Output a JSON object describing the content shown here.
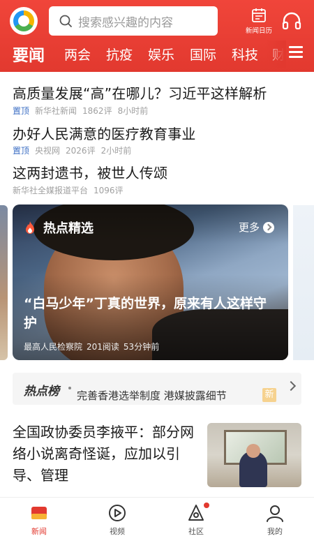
{
  "header": {
    "search_placeholder": "搜索感兴趣的内容",
    "calendar_label": "新闻日历",
    "brand_color": "#e2392f",
    "icons": [
      "app-logo-icon",
      "search-icon",
      "calendar-icon",
      "headphone-icon",
      "menu-icon"
    ]
  },
  "channels": [
    "要闻",
    "两会",
    "抗疫",
    "娱乐",
    "国际",
    "科技",
    "财"
  ],
  "feed": [
    {
      "title": "高质量发展“高”在哪儿？习近平这样解析",
      "pin": "置顶",
      "source": "新华社新闻",
      "comments": "1862评",
      "time": "8小时前"
    },
    {
      "title": "办好人民满意的医疗教育事业",
      "pin": "置顶",
      "source": "央视网",
      "comments": "2026评",
      "time": "2小时前"
    },
    {
      "title": "这两封遗书，被世人传颂",
      "source": "新华社全媒报道平台",
      "comments": "1096评"
    }
  ],
  "hot_card": {
    "heading": "热点精选",
    "more": "更多",
    "title": "“白马少年”丁真的世界，原来有人这样守护",
    "source": "最高人民检察院",
    "reads": "201阅读",
    "time": "53分钟前"
  },
  "hot_rank": {
    "label": "热点榜",
    "text": "完善香港选举制度 港媒披露细节",
    "badge": "新"
  },
  "article": {
    "title": "全国政协委员李掖平：部分网络小说离奇怪诞，应加以引导、管理"
  },
  "nav": {
    "items": [
      {
        "label": "新闻",
        "icon": "news-icon",
        "active": true
      },
      {
        "label": "视频",
        "icon": "play-icon"
      },
      {
        "label": "社区",
        "icon": "community-icon"
      },
      {
        "label": "我的",
        "icon": "profile-icon"
      }
    ]
  }
}
